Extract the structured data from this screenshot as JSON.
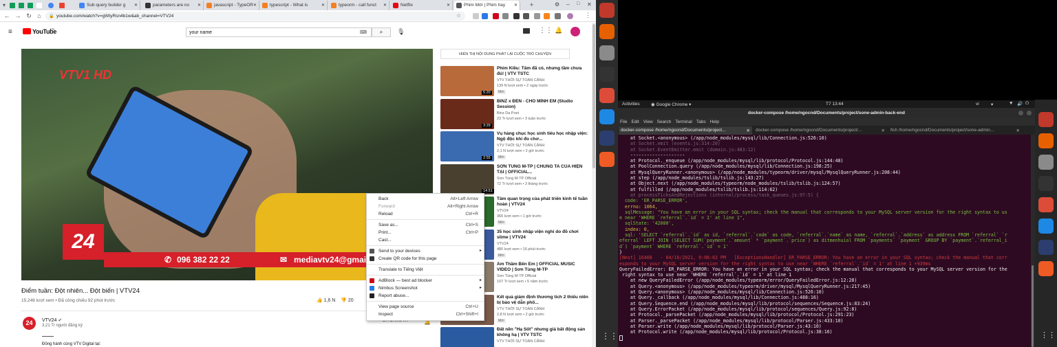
{
  "browser": {
    "tabs": [
      {
        "label": "Sub query builder g",
        "color": "#4285f4"
      },
      {
        "label": "parameters are no",
        "color": "#333333"
      },
      {
        "label": "javascript - TypeOR",
        "color": "#f48024"
      },
      {
        "label": "typescript - What is",
        "color": "#f48024"
      },
      {
        "label": "typeorm - call funct",
        "color": "#f48024"
      },
      {
        "label": "Netflix",
        "color": "#e50914"
      },
      {
        "label": "Phim Mới | Phim hay",
        "color": "#555555"
      }
    ],
    "url": "youtube.com/watch?v=gWtyRsn4b1w&ab_channel=VTV24"
  },
  "youtube": {
    "logo": "YouTube",
    "region": "VN",
    "search_value": "your name",
    "video_overlay": {
      "channel_logo": "VTV1 HD",
      "badge": "24",
      "phone": "096 382 22 22",
      "email": "mediavtv24@gmail.com"
    },
    "video_title": "Điểm tuần: Đột nhiên... Đột biến | VTV24",
    "video_meta": "15.246 lượt xem • Đã công chiếu 92 phút trước",
    "likes": "1,6 N",
    "dislikes": "20",
    "channel": {
      "avatar": "24",
      "name": "VTV24",
      "subs": "3,21 Tr người đăng ký",
      "desc": "Đồng hành cùng VTV Digital tại:",
      "subscribe": "ĐÃ ĐĂNG KÝ"
    },
    "chat_replay": "HIỂN THỊ NỘI DUNG PHÁT LẠI CUỘC TRÒ CHUYỆN",
    "recs": [
      {
        "title": "Phim Kiều: Tâm đã có, nhưng tầm chưa đủ! | VTV TSTC",
        "channel": "VTV THỜI SỰ TOÀN CẢNH",
        "views": "139 N lượt xem • 2 ngày trước",
        "badge": "Mới",
        "dur": "5:20",
        "color": "#b86a3a"
      },
      {
        "title": "BINZ x ĐEN - CHO MÌNH EM (Studio Session)",
        "channel": "Binz Da Poet",
        "views": "23 Tr lượt xem • 3 tuần trước",
        "badge": "",
        "dur": "3:29",
        "color": "#6a2a1a"
      },
      {
        "title": "Vụ hàng chục học sinh tiểu học nhập viện: Ngộ độc khi đo chơ...",
        "channel": "VTV THỜI SỰ TOÀN CẢNH",
        "views": "2,1 N lượt xem • 2 giờ trước",
        "badge": "Mới",
        "dur": "2:55",
        "color": "#3a6ab0"
      },
      {
        "title": "SƠN TÙNG M-TP | CHÚNG TA CỦA HIỆN TẠI | OFFICIAL...",
        "channel": "Sơn Tùng M-TP Official",
        "views": "72 Tr lượt xem • 3 tháng trước",
        "badge": "",
        "dur": "14:51",
        "color": "#4a4030"
      },
      {
        "title": "Tâm quan trọng của phát triển kinh tế tuần hoàn | VTV24",
        "channel": "VTV24",
        "views": "366 lượt xem • 1 giờ trước",
        "badge": "Mới",
        "dur": "",
        "color": "#2a6a2a"
      },
      {
        "title": "35 học sinh nhập viện nghi do đồ chơi slime | VTV24",
        "channel": "VTV24",
        "views": "480 lượt xem • 16 phút trước",
        "badge": "Mới",
        "dur": "",
        "color": "#3a5aa0"
      },
      {
        "title": "Âm Thầm Bên Em | OFFICIAL MUSIC VIDEO | Sơn Tùng M-TP",
        "channel": "Sơn Tùng M-TP Official",
        "views": "107 Tr lượt xem • 5 năm trước",
        "badge": "",
        "dur": "",
        "color": "#8a7a6a"
      },
      {
        "title": "Kết quả giám định thương tích 2 thiếu niên bị bảo vệ dẫn phố...",
        "channel": "VTV THỜI SỰ TOÀN CẢNH",
        "views": "2,8 N lượt xem • 2 giờ trước",
        "badge": "Mới",
        "dur": "",
        "color": "#7a5a4a"
      },
      {
        "title": "Đất nền \"Hạ Sốt\" nhưng giá bất động sản không hạ | VTV TSTC",
        "channel": "VTV THỜI SỰ TOÀN CẢNH",
        "views": "",
        "badge": "",
        "dur": "",
        "color": "#2a5aa0"
      }
    ]
  },
  "context_menu": {
    "groups": [
      [
        {
          "label": "Back",
          "shortcut": "Alt+Left Arrow"
        },
        {
          "label": "Forward",
          "shortcut": "Alt+Right Arrow",
          "disabled": true
        },
        {
          "label": "Reload",
          "shortcut": "Ctrl+R"
        }
      ],
      [
        {
          "label": "Save as...",
          "shortcut": "Ctrl+S"
        },
        {
          "label": "Print...",
          "shortcut": "Ctrl+P"
        },
        {
          "label": "Cast...",
          "shortcut": ""
        }
      ],
      [
        {
          "label": "Send to your devices",
          "shortcut": "",
          "icon": "#555555",
          "submenu": true
        },
        {
          "label": "Create QR code for this page",
          "shortcut": "",
          "icon": "#333333"
        }
      ],
      [
        {
          "label": "Translate to Tiếng Việt",
          "shortcut": ""
        }
      ],
      [
        {
          "label": "AdBlock — best ad blocker",
          "shortcut": "",
          "icon": "#d0021b",
          "submenu": true
        },
        {
          "label": "Nimbus Screenshot",
          "shortcut": "",
          "icon": "#2a7ae4",
          "submenu": true
        },
        {
          "label": "Report abuse...",
          "shortcut": "",
          "icon": "#222222"
        }
      ],
      [
        {
          "label": "View page source",
          "shortcut": "Ctrl+U"
        },
        {
          "label": "Inspect",
          "shortcut": "Ctrl+Shift+I"
        }
      ]
    ]
  },
  "gnome": {
    "activities": "Activities",
    "app": "Google Chrome",
    "clock": "T7 13:44",
    "lang": "vi"
  },
  "terminal": {
    "title": "docker-compose /home/ngocnd/Documents/project/sone-admin-back-end",
    "menu": [
      "File",
      "Edit",
      "View",
      "Search",
      "Terminal",
      "Tabs",
      "Help"
    ],
    "tabs": [
      "docker-compose /home/ngocnd/Documents/project...",
      "docker-compose /home/ngocnd/Documents/project/...",
      "fish /home/ngocnd/Documents/project/sone-admin..."
    ],
    "lines": [
      {
        "t": "    at Socket.<anonymous> (/app/node_modules/mysql/lib/Connection.js:526:10)",
        "c": ""
      },
      {
        "t": "    at Socket.emit (events.js:314:20)",
        "c": "dim"
      },
      {
        "t": "    at Socket.EventEmitter.emit (domain.js:483:12)",
        "c": "dim"
      },
      {
        "t": "    --------------------",
        "c": ""
      },
      {
        "t": "    at Protocol._enqueue (/app/node_modules/mysql/lib/protocol/Protocol.js:144:48)",
        "c": ""
      },
      {
        "t": "    at PoolConnection.query (/app/node_modules/mysql/lib/Connection.js:198:25)",
        "c": ""
      },
      {
        "t": "    at MysqlQueryRunner.<anonymous> (/app/node_modules/typeorm/driver/mysql/MysqlQueryRunner.js:208:44)",
        "c": ""
      },
      {
        "t": "    at step (/app/node_modules/tslib/tslib.js:143:27)",
        "c": ""
      },
      {
        "t": "    at Object.next (/app/node_modules/typeorm/node_modules/tslib/tslib.js:124:57)",
        "c": ""
      },
      {
        "t": "    at fulfilled (/app/node_modules/tslib/tslib.js:114:62)",
        "c": ""
      },
      {
        "t": "    at processTicksAndRejections (internal/process/task_queues.js:97:5) {",
        "c": "dim"
      },
      {
        "t": "  code: 'ER_PARSE_ERROR',",
        "c": "grn"
      },
      {
        "t": "  errno: 1064,",
        "c": "ylw"
      },
      {
        "t": "  sqlMessage: \"You have an error in your SQL syntax; check the manual that corresponds to your MySQL server version for the right syntax to us",
        "c": "grn"
      },
      {
        "t": "e near 'WHERE `referral`.`id` = 1' at line 1\",",
        "c": "grn"
      },
      {
        "t": "  sqlState: '42000',",
        "c": "grn"
      },
      {
        "t": "  index: 0,",
        "c": "ylw"
      },
      {
        "t": "  sql: 'SELECT `referral`.`id` as id, `referral`.`code` as code, `referral`.`name` as name, `referral`.`address` as address FROM `referral` `r",
        "c": "grn"
      },
      {
        "t": "eferral` LEFT JOIN (SELECT SUM(`payment`.`amount` * `payment`.`price`) as ditmenhuiol FROM `payments` `payment` GROUP BY `payment`.`referral_i",
        "c": "grn"
      },
      {
        "t": "d`) `payment` WHERE `referral`.`id` = 1'",
        "c": "grn"
      },
      {
        "t": "}",
        "c": ""
      },
      {
        "t": "[Nest] 16468   - 04/16/2021, 9:08:02 PM   [ExceptionsHandler] ER_PARSE_ERROR: You have an error in your SQL syntax; check the manual that corr",
        "c": "red"
      },
      {
        "t": "esponds to your MySQL server version for the right syntax to use near 'WHERE `referral`.`id` = 1' at line 1 +939ms",
        "c": "red"
      },
      {
        "t": "QueryFailedError: ER_PARSE_ERROR: You have an error in your SQL syntax; check the manual that corresponds to your MySQL server version for the",
        "c": ""
      },
      {
        "t": " right syntax to use near 'WHERE `referral`.`id` = 1' at line 1",
        "c": ""
      },
      {
        "t": "    at new QueryFailedError (/app/node_modules/typeorm/error/QueryFailedError.js:12:28)",
        "c": ""
      },
      {
        "t": "    at Query.<anonymous> (/app/node_modules/typeorm/driver/mysql/MysqlQueryRunner.js:217:45)",
        "c": ""
      },
      {
        "t": "    at Query.<anonymous> (/app/node_modules/mysql/lib/Connection.js:526:10)",
        "c": ""
      },
      {
        "t": "    at Query._callback (/app/node_modules/mysql/lib/Connection.js:488:16)",
        "c": ""
      },
      {
        "t": "    at Query.Sequence.end (/app/node_modules/mysql/lib/protocol/sequences/Sequence.js:83:24)",
        "c": ""
      },
      {
        "t": "    at Query.ErrorPacket (/app/node_modules/mysql/lib/protocol/sequences/Query.js:92:8)",
        "c": ""
      },
      {
        "t": "    at Protocol._parsePacket (/app/node_modules/mysql/lib/protocol/Protocol.js:291:23)",
        "c": ""
      },
      {
        "t": "    at Parser._parsePacket (/app/node_modules/mysql/lib/protocol/Parser.js:433:10)",
        "c": ""
      },
      {
        "t": "    at Parser.write (/app/node_modules/mysql/lib/protocol/Parser.js:43:10)",
        "c": ""
      },
      {
        "t": "    at Protocol.write (/app/node_modules/mysql/lib/protocol/Protocol.js:38:16)",
        "c": ""
      }
    ]
  },
  "dock": {
    "icons": [
      {
        "name": "settings-icon",
        "color": "#c0392b"
      },
      {
        "name": "firefox-icon",
        "color": "#e66000"
      },
      {
        "name": "files-icon",
        "color": "#8a8a8a"
      },
      {
        "name": "terminal-icon",
        "color": "#333333"
      },
      {
        "name": "chrome-icon",
        "color": "#dd4b39"
      },
      {
        "name": "vscode-icon",
        "color": "#1e88e5"
      },
      {
        "name": "network-icon",
        "color": "#2c3e70"
      },
      {
        "name": "postman-icon",
        "color": "#ef5b25"
      }
    ]
  }
}
